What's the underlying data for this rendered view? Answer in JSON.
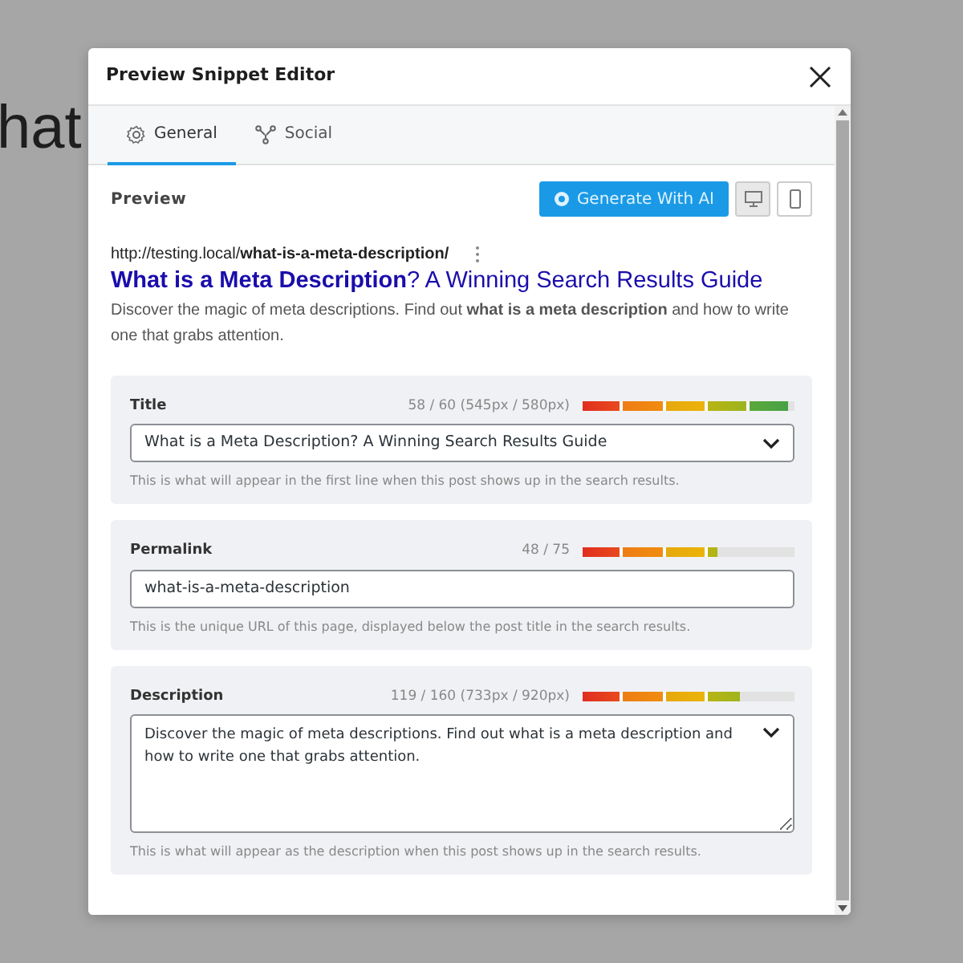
{
  "background_text": "hat",
  "dialog": {
    "title": "Preview Snippet Editor"
  },
  "tabs": [
    {
      "label": "General",
      "kind": "gear",
      "selected": true
    },
    {
      "label": "Social",
      "kind": "share",
      "selected": false
    }
  ],
  "preview": {
    "heading": "Preview",
    "generate_button": "Generate With AI",
    "device_buttons": [
      {
        "kind": "desktop",
        "selected": true
      },
      {
        "kind": "mobile",
        "selected": false
      }
    ],
    "url": "http://testing.local/**what-is-a-meta-description/**",
    "title": "**What is a Meta Description**? A Winning Search Results Guide",
    "description": "Discover the magic of meta descriptions. Find out **what is a meta description** and how to write one that grabs attention."
  },
  "fields": [
    {
      "label": "Title",
      "kind": "select",
      "count": "58 / 60 (545px / 580px)",
      "level": 0.97,
      "value": "What is a Meta Description? A Winning Search Results Guide",
      "help": "This is what will appear in the first line when this post shows up in the search results."
    },
    {
      "label": "Permalink",
      "kind": "input",
      "count": "48 / 75",
      "level": 0.64,
      "value": "what-is-a-meta-description",
      "help": "This is the unique URL of this page, displayed below the post title in the search results."
    },
    {
      "label": "Description",
      "kind": "textarea",
      "count": "119 / 160 (733px / 920px)",
      "level": 0.74,
      "value": "Discover the magic of meta descriptions. Find out what is a meta description and how to write one that grabs attention.",
      "help": "This is what will appear as the description when this post shows up in the search results."
    }
  ]
}
